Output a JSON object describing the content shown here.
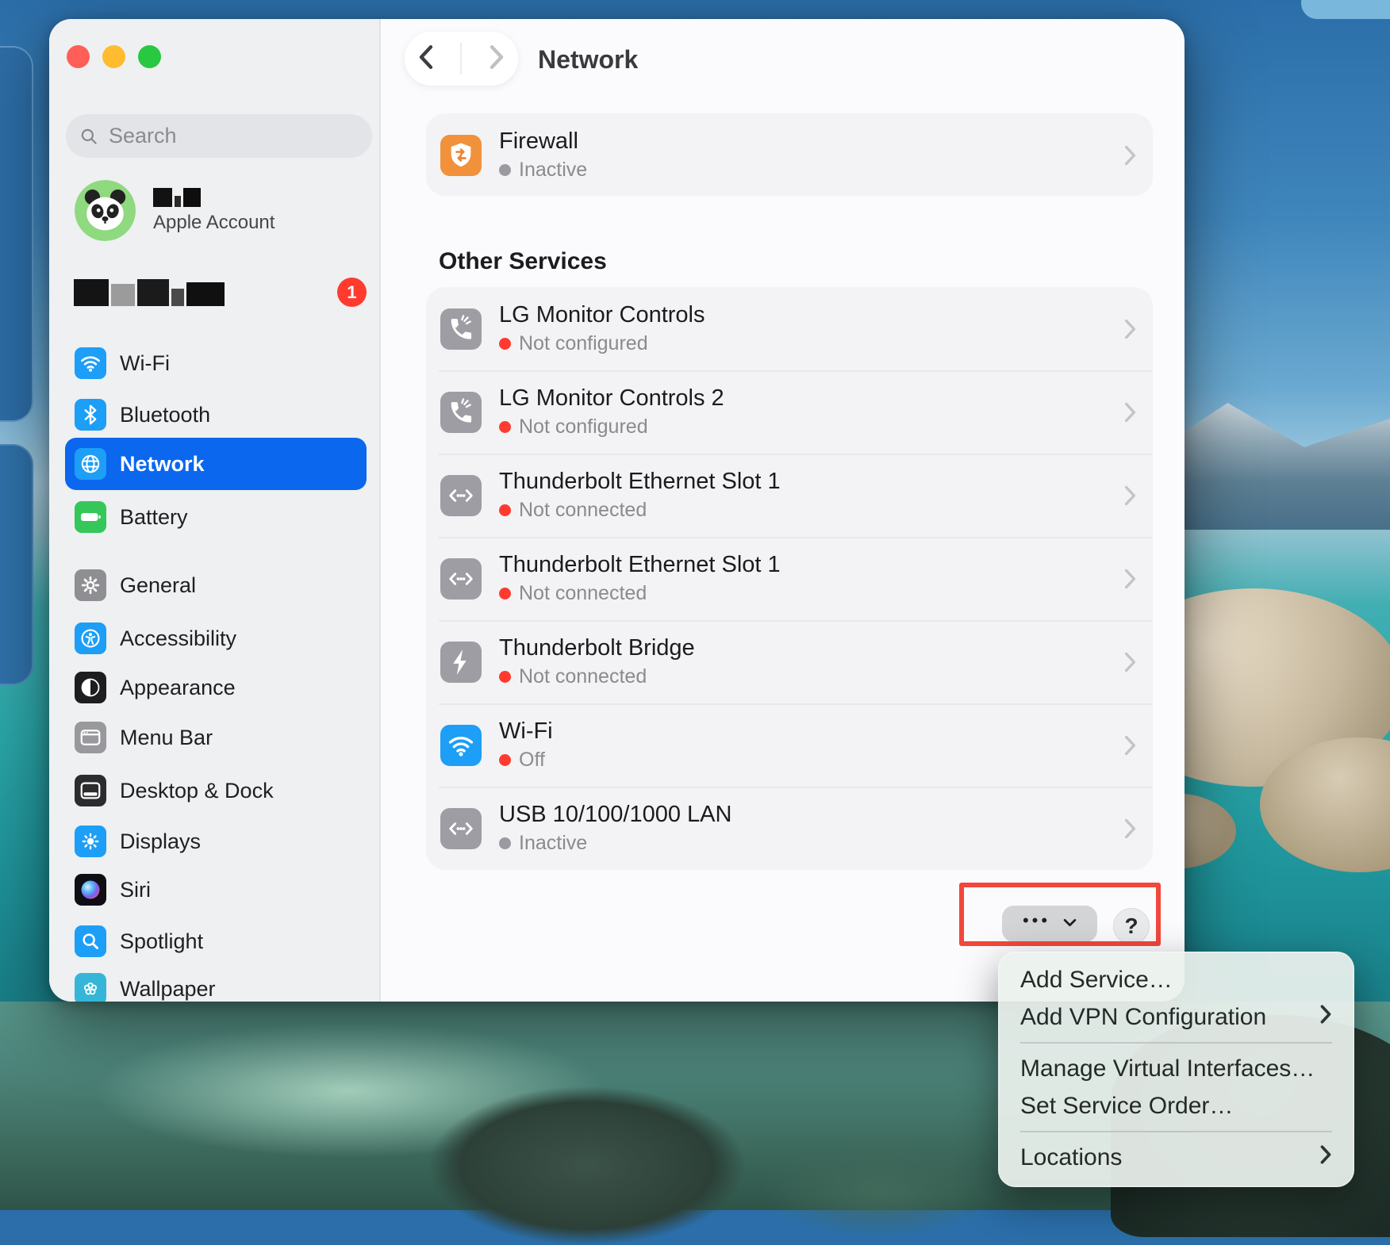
{
  "window": {
    "traffic_lights": {
      "close": "#ff5f57",
      "minimize": "#febc2e",
      "zoom": "#28c840"
    }
  },
  "sidebar": {
    "search": {
      "placeholder": "Search"
    },
    "account": {
      "label": "Apple Account",
      "badge": "1"
    },
    "groups": [
      [
        {
          "label": "Wi-Fi",
          "icon": "wifi",
          "bg": "#1d9ef7"
        },
        {
          "label": "Bluetooth",
          "icon": "bluetooth",
          "bg": "#1d9ef7"
        },
        {
          "label": "Network",
          "icon": "globe",
          "bg": "#1d9ef7",
          "selected": true
        },
        {
          "label": "Battery",
          "icon": "battery",
          "bg": "#35c759"
        }
      ],
      [
        {
          "label": "General",
          "icon": "gear",
          "bg": "#8e8e93"
        },
        {
          "label": "Accessibility",
          "icon": "accessibility",
          "bg": "#1d9ef7"
        },
        {
          "label": "Appearance",
          "icon": "appearance",
          "bg": "#1d1d1f"
        },
        {
          "label": "Menu Bar",
          "icon": "menubar",
          "bg": "#98989d"
        },
        {
          "label": "Desktop & Dock",
          "icon": "desktopdock",
          "bg": "#2c2c2e"
        },
        {
          "label": "Displays",
          "icon": "display",
          "bg": "#1d9ef7"
        },
        {
          "label": "Siri",
          "icon": "siri",
          "bg": "#0e0e14"
        },
        {
          "label": "Spotlight",
          "icon": "spotlight",
          "bg": "#1d9ef7"
        },
        {
          "label": "Wallpaper",
          "icon": "wallpaperic",
          "bg": "#35b6d9"
        }
      ]
    ]
  },
  "header": {
    "title": "Network"
  },
  "main": {
    "firewall": {
      "title": "Firewall",
      "status": "Inactive",
      "status_color": "#9a9aa0",
      "icon": "shield",
      "bg": "#f1913c"
    },
    "section_title": "Other Services",
    "services": [
      {
        "title": "LG Monitor Controls",
        "status": "Not configured",
        "status_color": "#ff3b30",
        "icon": "phone",
        "bg": "#9d9da3"
      },
      {
        "title": "LG Monitor Controls 2",
        "status": "Not configured",
        "status_color": "#ff3b30",
        "icon": "phone",
        "bg": "#9d9da3"
      },
      {
        "title": "Thunderbolt Ethernet Slot 1",
        "status": "Not connected",
        "status_color": "#ff3b30",
        "icon": "ethernet",
        "bg": "#9d9da3"
      },
      {
        "title": "Thunderbolt Ethernet Slot 1",
        "status": "Not connected",
        "status_color": "#ff3b30",
        "icon": "ethernet",
        "bg": "#9d9da3"
      },
      {
        "title": "Thunderbolt Bridge",
        "status": "Not connected",
        "status_color": "#ff3b30",
        "icon": "bolt",
        "bg": "#9d9da3"
      },
      {
        "title": "Wi-Fi",
        "status": "Off",
        "status_color": "#ff3b30",
        "icon": "wifi",
        "bg": "#1d9ef7"
      },
      {
        "title": "USB 10/100/1000 LAN",
        "status": "Inactive",
        "status_color": "#9a9aa0",
        "icon": "ethernet",
        "bg": "#9d9da3"
      }
    ],
    "more_dots": "•••",
    "help_label": "?"
  },
  "context_menu": {
    "items": [
      {
        "label": "Add Service…"
      },
      {
        "label": "Add VPN Configuration",
        "submenu": true
      },
      {
        "divider": true
      },
      {
        "label": "Manage Virtual Interfaces…"
      },
      {
        "label": "Set Service Order…"
      },
      {
        "divider": true
      },
      {
        "label": "Locations",
        "submenu": true
      }
    ]
  },
  "colors": {
    "selection_blue": "#0a67ee",
    "highlight_box_red": "#f2473c",
    "status_red": "#ff3b30",
    "status_gray": "#9a9aa0"
  }
}
